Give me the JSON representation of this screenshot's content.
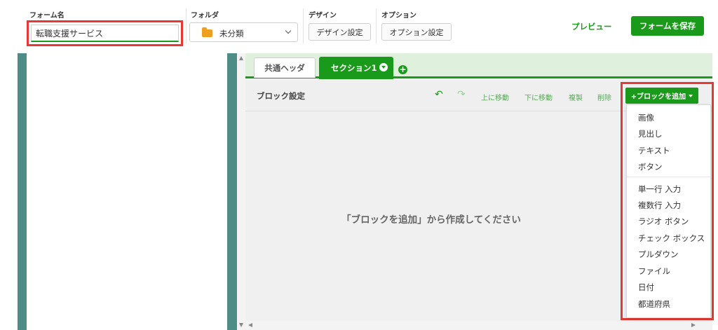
{
  "header": {
    "form_name_label": "フォーム名",
    "form_name_value": "転職支援サービス",
    "folder_label": "フォルダ",
    "folder_value": "未分類",
    "design_label": "デザイン",
    "design_button": "デザイン設定",
    "option_label": "オプション",
    "option_button": "オプション設定",
    "preview": "プレビュー",
    "save": "フォームを保存"
  },
  "tabs": {
    "common_header": "共通ヘッダ",
    "section1": "セクション1",
    "add_tab": "+"
  },
  "toolbar": {
    "title": "ブロック設定",
    "undo_icon": "↶",
    "redo_icon": "↷",
    "move_up": "上に移動",
    "move_down": "下に移動",
    "duplicate": "複製",
    "delete": "削除",
    "add_block": "+ブロックを追加"
  },
  "empty_message": "「ブロックを追加」から作成してください",
  "add_block_menu": {
    "group1": [
      "画像",
      "見出し",
      "テキスト",
      "ボタン"
    ],
    "group2": [
      "単一行 入力",
      "複数行 入力",
      "ラジオ ボタン",
      "チェック ボックス",
      "プルダウン",
      "ファイル",
      "日付",
      "都道府県"
    ]
  },
  "colors": {
    "accent_green": "#1a9a1a",
    "highlight_red": "#e53935",
    "panel_teal": "#4e8c88",
    "tabbar_bg": "#dff1dd",
    "folder_orange": "#f0a020"
  },
  "icons": {
    "folder": "folder-icon",
    "chevron": "chevron-down-icon",
    "undo": "undo-icon",
    "redo": "redo-icon"
  }
}
